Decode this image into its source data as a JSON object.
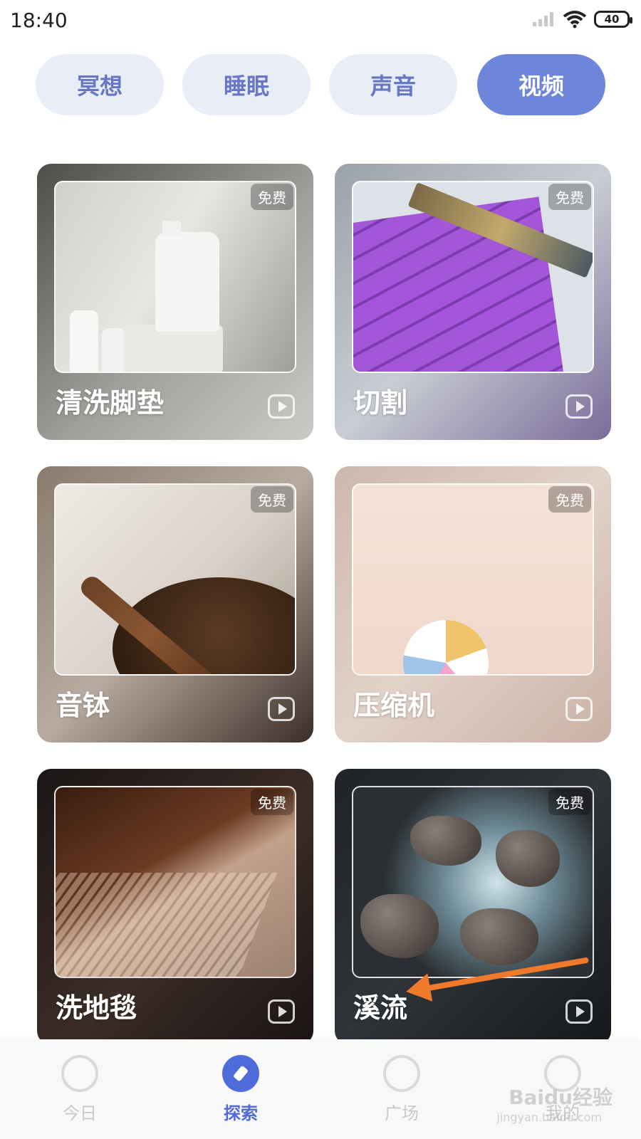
{
  "status_bar": {
    "time": "18:40",
    "battery": "40"
  },
  "tabs": [
    {
      "label": "冥想",
      "active": false
    },
    {
      "label": "睡眠",
      "active": false
    },
    {
      "label": "声音",
      "active": false
    },
    {
      "label": "视频",
      "active": true
    }
  ],
  "cards": [
    {
      "title": "清洗脚垫",
      "badge": "免费"
    },
    {
      "title": "切割",
      "badge": "免费"
    },
    {
      "title": "音钵",
      "badge": "免费"
    },
    {
      "title": "压缩机",
      "badge": "免费"
    },
    {
      "title": "洗地毯",
      "badge": "免费"
    },
    {
      "title": "溪流",
      "badge": "免费"
    }
  ],
  "bottom_nav": [
    {
      "label": "今日",
      "icon": "trend-icon",
      "active": false
    },
    {
      "label": "探索",
      "icon": "compass-icon",
      "active": true
    },
    {
      "label": "广场",
      "icon": "planet-icon",
      "active": false
    },
    {
      "label": "我的",
      "icon": "leaf-icon",
      "active": false
    }
  ],
  "watermark": {
    "text": "Baidu经验",
    "sub": "jingyan.baidu.com"
  },
  "colors": {
    "accent": "#6e86da",
    "nav_active": "#4f6bd9",
    "tab_inactive_bg": "#e9edf8",
    "annotation_arrow": "#f07a2c"
  }
}
